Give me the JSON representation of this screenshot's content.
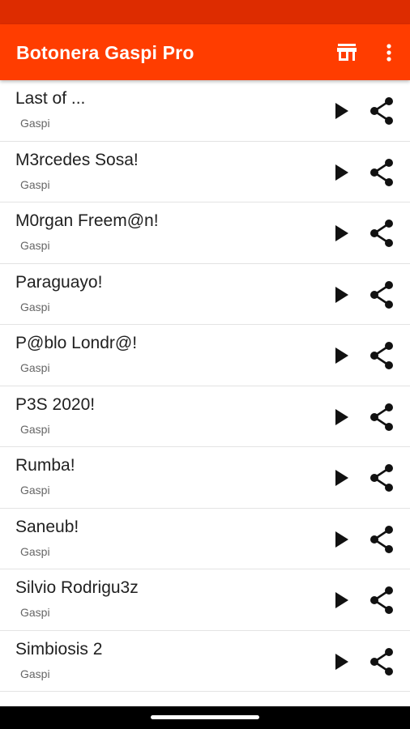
{
  "colors": {
    "status_bar": "#dd2c00",
    "app_bar": "#ff3d00",
    "text_primary": "#212121",
    "text_secondary": "#666666"
  },
  "app_bar": {
    "title": "Botonera Gaspi Pro",
    "actions": [
      {
        "name": "store-icon"
      },
      {
        "name": "more-vert-icon"
      }
    ]
  },
  "list": {
    "items": [
      {
        "title": "Last of ...",
        "subtitle": "Gaspi"
      },
      {
        "title": "M3rcedes Sosa!",
        "subtitle": "Gaspi"
      },
      {
        "title": "M0rgan Freem@n!",
        "subtitle": "Gaspi"
      },
      {
        "title": "Paraguayo!",
        "subtitle": "Gaspi"
      },
      {
        "title": "P@blo Londr@!",
        "subtitle": "Gaspi"
      },
      {
        "title": "P3S 2020!",
        "subtitle": "Gaspi"
      },
      {
        "title": "Rumba!",
        "subtitle": "Gaspi"
      },
      {
        "title": "Saneub!",
        "subtitle": "Gaspi"
      },
      {
        "title": "Silvio Rodrigu3z",
        "subtitle": "Gaspi"
      },
      {
        "title": "Simbiosis 2",
        "subtitle": "Gaspi"
      }
    ],
    "item_icons": {
      "play": "play-icon",
      "share": "share-icon"
    }
  }
}
